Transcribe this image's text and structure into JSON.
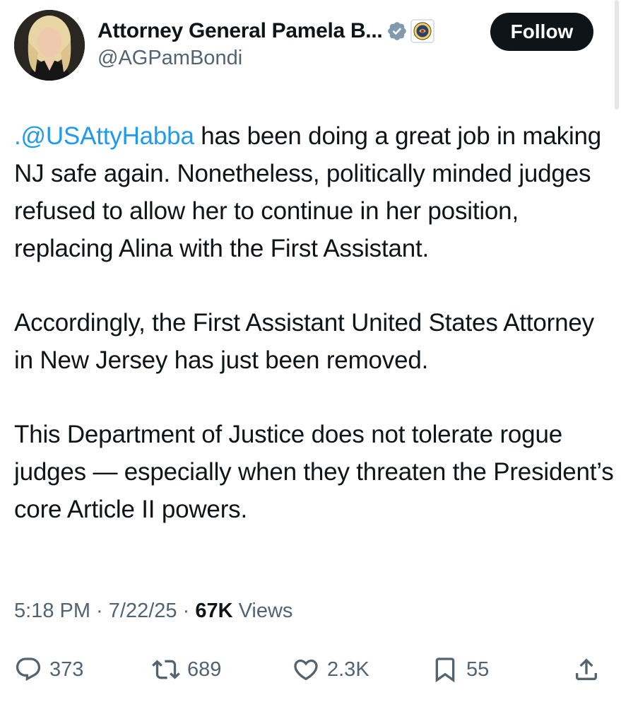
{
  "author": {
    "display_name": "Attorney General Pamela B...",
    "handle": "@AGPamBondi",
    "verified_badge": "verified-badge-icon",
    "affiliate_badge": "doj-seal-icon"
  },
  "follow_label": "Follow",
  "tweet": {
    "paragraph1_mention": ".@USAttyHabba",
    "paragraph1_rest": " has been doing a great job in making NJ safe again. Nonetheless, politically minded judges refused to allow her to continue in her position, replacing Alina with the First Assistant.",
    "paragraph2": "Accordingly, the First Assistant United States Attorney in New Jersey has just been removed.",
    "paragraph3": "This Department of Justice does not tolerate rogue judges — especially when they threaten the President’s core Article II powers."
  },
  "meta": {
    "time": "5:18 PM",
    "sep1": " · ",
    "date": "7/22/25",
    "sep2": " · ",
    "views_count": "67K",
    "views_label": " Views"
  },
  "actions": {
    "replies": "373",
    "reposts": "689",
    "likes": "2.3K",
    "bookmarks": "55"
  },
  "colors": {
    "text": "#0f1419",
    "secondary": "#536471",
    "link": "#1d9bf0",
    "button_bg": "#0f1419"
  }
}
